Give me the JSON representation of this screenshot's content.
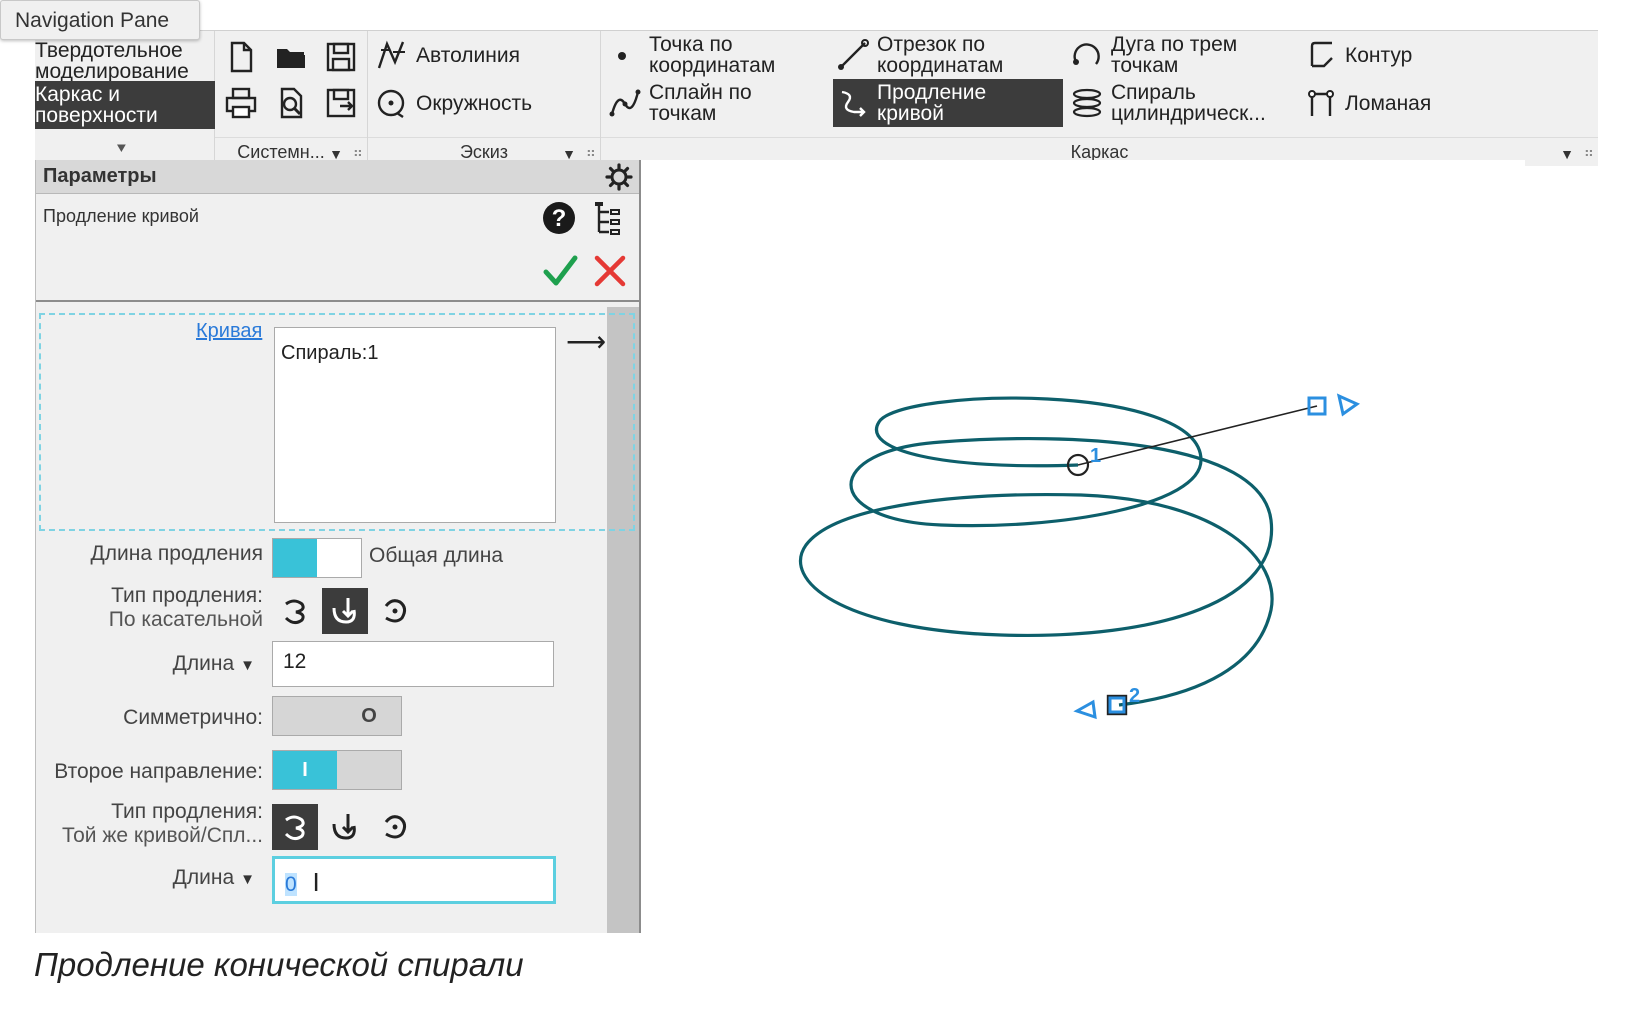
{
  "nav_pane": {
    "label": "Navigation Pane"
  },
  "ribbon": {
    "modes": [
      {
        "label": "Твердотельное моделирование",
        "active": false
      },
      {
        "label": "Каркас и поверхности",
        "active": true
      }
    ],
    "groups": [
      {
        "label": "Системн..."
      },
      {
        "label": "Эскиз"
      },
      {
        "label": "Каркас"
      }
    ],
    "sketch_cmds": [
      {
        "label": "Автолиния",
        "icon": "autoline-icon"
      },
      {
        "label": "Окружность",
        "icon": "circle-icon"
      }
    ],
    "frame_cmds": [
      {
        "label": "Точка по координатам",
        "icon": "point-icon"
      },
      {
        "label": "Отрезок по координатам",
        "icon": "segment-icon"
      },
      {
        "label": "Дуга по трем точкам",
        "icon": "arc-icon"
      },
      {
        "label": "Контур",
        "icon": "contour-icon"
      },
      {
        "label": "Сплайн по точкам",
        "icon": "spline-icon"
      },
      {
        "label": "Продление кривой",
        "icon": "extend-curve-icon"
      },
      {
        "label": "Спираль цилиндрическ...",
        "icon": "spiral-icon"
      },
      {
        "label": "Ломаная",
        "icon": "polyline-icon"
      }
    ]
  },
  "params": {
    "header": "Параметры",
    "command_title": "Продление кривой",
    "curve_link": "Кривая",
    "curve_value": "Спираль:1",
    "length_mode_label": "Длина продления",
    "length_mode_value": "Общая длина",
    "ext_type1_label": "Тип продления:",
    "ext_type1_value": "По касательной",
    "length1_label": "Длина",
    "length1_value": "12",
    "symmetric_label": "Симметрично:",
    "symmetric_state": "O",
    "second_dir_label": "Второе направление:",
    "second_dir_state": "I",
    "ext_type2_label": "Тип продления:",
    "ext_type2_value": "Той же кривой/Спл...",
    "length2_label": "Длина",
    "length2_value": "0"
  },
  "viewport": {
    "point1_label": "1",
    "point2_label": "2",
    "curve_color": "#0d5f6b",
    "handle_color": "#2b8fe0"
  },
  "caption": "Продление конической спирали"
}
